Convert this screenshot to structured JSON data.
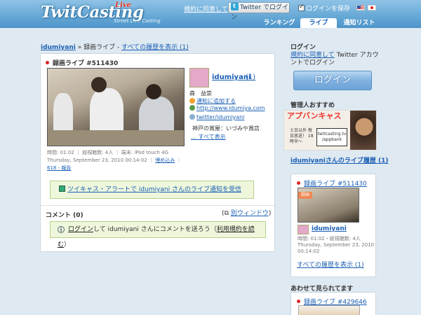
{
  "header": {
    "logo": "TwitCasting",
    "logo_live": "Live",
    "tagline": "Street Live Casting",
    "terms_link": "規約に同意して",
    "login_button": "Twitter でログイン",
    "save_login_label": "ログインを保存",
    "save_login_checked": true,
    "tabs": [
      {
        "label": "ランキング",
        "active": false
      },
      {
        "label": "ライブ",
        "active": true
      },
      {
        "label": "通知リスト",
        "active": false
      }
    ]
  },
  "breadcrumb": {
    "user": "idumiyani",
    "separator": "»",
    "section": "録画ライブ",
    "dash": "-",
    "all_history": "すべての履歴を表示 (1)"
  },
  "recording": {
    "title": "録画ライブ #511430",
    "user_name": "idumiyani",
    "user_count": "(1)",
    "real_name": "森　益崇",
    "add_notify": "通知に追加する",
    "homepage": "http://www.idumiya.com",
    "twitter": "twitter/idumiyani",
    "profile": "神戸の賞屋：いづみや賞店",
    "show_all": "… すべて表示",
    "meta_time": "時間: 01:02",
    "meta_viewers": "総視聴数: 4人",
    "meta_device": "端末: iPod touch 4G",
    "meta_date": "Thursday, September 23, 2010 00:14:02",
    "meta_embed": "埋め込み",
    "meta_report": "618 - 報告",
    "alert_text": "ツイキャス・アラートで idumiyani さんのライブ通知を受信"
  },
  "comments": {
    "title": "コメント (0)",
    "popout": "別ウィンドウ",
    "login_link": "ログイン",
    "prompt_mid": "して idumiyani さんにコメントを送ろう（",
    "terms_link": "利用規約を読む",
    "prompt_end": "）"
  },
  "sidebar": {
    "login_title": "ログイン",
    "login_desc_link": "規約に同意して",
    "login_desc_rest": " Twitter アカウントでログイン",
    "login_button": "ログイン",
    "admin_title": "管理人おすすめ",
    "banner_title": "アプバンキャス",
    "banner_sub": "土日以外 毎日放送！ 18時半～",
    "banner_url": "twitcasting.tv /appbank",
    "history_title": "idumiyaniさんのライブ履歴 (1)",
    "history_item_title": "録画ライブ #511430",
    "history_badge": "録画",
    "history_user": "idumiyani",
    "history_meta": "時間: 01:02・総視聴数: 4人 Thursday, September 23, 2010 00:14:02",
    "history_all": "すべての履歴を表示 (1)",
    "also_title": "あわせて見られてます",
    "also_item_title": "録画ライブ #429646"
  }
}
